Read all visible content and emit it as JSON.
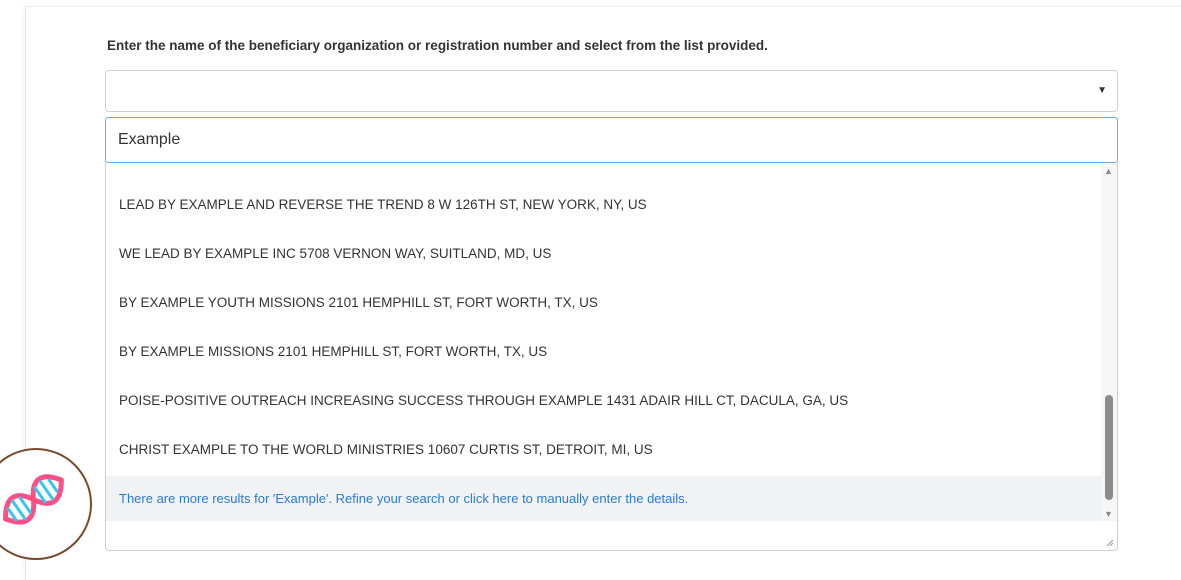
{
  "form": {
    "instruction": "Enter the name of the beneficiary organization or registration number and select from the list provided.",
    "select_value": "",
    "search_value": "Example",
    "results": [
      "LEAD BY EXAMPLE AND REVERSE THE TREND 8 W 126TH ST, NEW YORK, NY, US",
      "WE LEAD BY EXAMPLE INC 5708 VERNON WAY, SUITLAND, MD, US",
      "BY EXAMPLE YOUTH MISSIONS 2101 HEMPHILL ST, FORT WORTH, TX, US",
      "BY EXAMPLE MISSIONS 2101 HEMPHILL ST, FORT WORTH, TX, US",
      "POISE-POSITIVE OUTREACH INCREASING SUCCESS THROUGH EXAMPLE 1431 ADAIR HILL CT, DACULA, GA, US",
      "CHRIST EXAMPLE TO THE WORLD MINISTRIES 10607 CURTIS ST, DETROIT, MI, US"
    ],
    "more_results": "There are more results for 'Example'. Refine your search or click here to manually enter the details."
  },
  "icons": {
    "select_arrow": "caret-down-icon",
    "scroll_up": "scroll-up-icon",
    "scroll_down": "scroll-down-icon",
    "logo": "dna-icon"
  },
  "colors": {
    "link": "#2a7bd4",
    "focus_border": "#66afe9",
    "highlight_row": "#f1f2f4"
  }
}
